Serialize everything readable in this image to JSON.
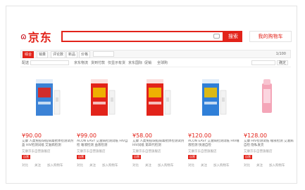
{
  "header": {
    "logo_text": "京东",
    "search_value": "",
    "search_button": "搜索",
    "cart_label": "我的购物车"
  },
  "sortbar": {
    "items": [
      "综合",
      "销量",
      "评论数",
      "新品",
      "价格"
    ],
    "page_info": "1/100"
  },
  "filterbar": {
    "location_label": "配送",
    "options": [
      "京东物流",
      "货到付款",
      "仅显示有货",
      "京东国际",
      "促销",
      "全球购"
    ],
    "search_button": "确定"
  },
  "products": [
    {
      "price": "¥90.00",
      "title": "艾康 人类免疫缺陷病毒抗体检测试剂盒 HIV检测试纸 艾滋病检测",
      "shop": "艾康京东自营旗舰店",
      "badge": "自营",
      "actions": [
        "对比",
        "关注",
        "加入购物车"
      ],
      "box_color": "#3b82d6",
      "box_accent": "#e2231a"
    },
    {
      "price": "¥99.00",
      "title": "ACON EASY 艾滋病检测试纸 HIV自检 唾液检测 血液检测",
      "shop": "艾康京东自营旗舰店",
      "badge": "自营",
      "actions": [
        "对比",
        "关注",
        "加入购物车"
      ],
      "box_color": "#e2231a",
      "box_accent": "#f0c000"
    },
    {
      "price": "¥58.00",
      "title": "艾康 人类免疫缺陷病毒抗体检测试剂 HIV试纸 第四代检测",
      "shop": "艾康京东自营旗舰店",
      "badge": "自营",
      "actions": [
        "对比",
        "关注",
        "加入购物车"
      ],
      "box_color": "#e2231a",
      "box_accent": "#f0c000"
    },
    {
      "price": "¥120.00",
      "title": "ACON EASY 艾滋病检测试纸 HIV唾液检测 快速自检",
      "shop": "艾康京东自营旗舰店",
      "badge": "自营",
      "actions": [
        "对比",
        "关注",
        "加入购物车"
      ],
      "box_color": "#2f7fd8",
      "box_accent": "#f0c000"
    },
    {
      "price": "¥128.00",
      "title": "艾康 HIV检测试纸 唾液检测 艾滋病自检 隐私发货",
      "shop": "艾康京东自营旗舰店",
      "badge": "自营",
      "actions": [
        "对比",
        "关注",
        "加入购物车"
      ],
      "box_color": "#f4a6b8",
      "box_accent": "#f7c4d0"
    }
  ]
}
